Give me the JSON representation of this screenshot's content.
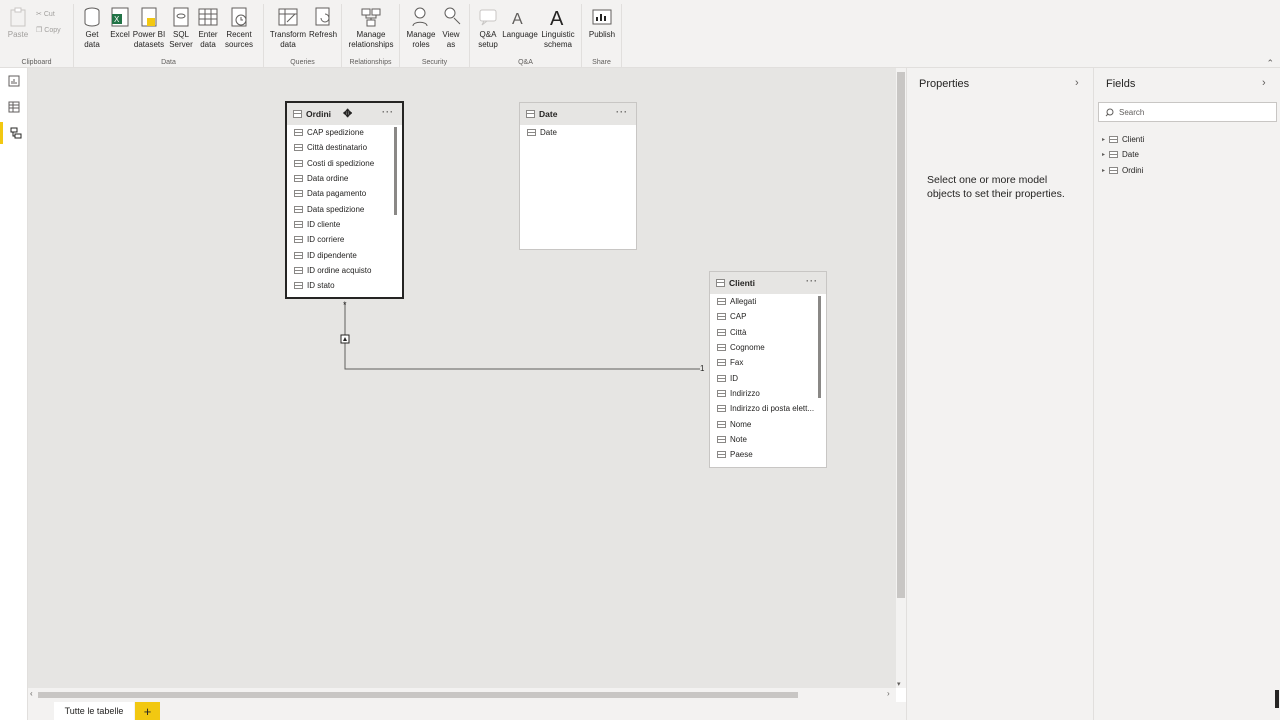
{
  "ribbon": {
    "clipboard": {
      "label": "Clipboard",
      "paste": "Paste",
      "cut": "Cut",
      "copy": "Copy"
    },
    "data": {
      "label": "Data",
      "get_data": "Get data",
      "excel": "Excel",
      "powerbi": "Power BI datasets",
      "sql": "SQL Server",
      "enter": "Enter data",
      "recent": "Recent sources"
    },
    "queries": {
      "label": "Queries",
      "transform": "Transform data",
      "refresh": "Refresh"
    },
    "relationships": {
      "label": "Relationships",
      "manage": "Manage relationships"
    },
    "security": {
      "label": "Security",
      "manage_roles": "Manage roles",
      "view_as": "View as"
    },
    "qa": {
      "label": "Q&A",
      "setup": "Q&A setup",
      "language": "Language",
      "linguistic": "Linguistic schema"
    },
    "share": {
      "label": "Share",
      "publish": "Publish"
    }
  },
  "tables": {
    "ordini": {
      "name": "Ordini",
      "fields": [
        "CAP spedizione",
        "Città destinatario",
        "Costi di spedizione",
        "Data ordine",
        "Data pagamento",
        "Data spedizione",
        "ID cliente",
        "ID corriere",
        "ID dipendente",
        "ID ordine acquisto",
        "ID stato"
      ]
    },
    "date": {
      "name": "Date",
      "fields": [
        "Date"
      ]
    },
    "clienti": {
      "name": "Clienti",
      "fields": [
        "Allegati",
        "CAP",
        "Città",
        "Cognome",
        "Fax",
        "ID",
        "Indirizzo",
        "Indirizzo di posta elett...",
        "Nome",
        "Note",
        "Paese"
      ]
    }
  },
  "relationship": {
    "from": "Ordini",
    "to": "Clienti",
    "one_side_label": "1",
    "many_side_label": "*"
  },
  "tabs": {
    "active": "Tutte le tabelle",
    "add": "+"
  },
  "properties": {
    "title": "Properties",
    "message": "Select one or more model objects to set their properties."
  },
  "fields_pane": {
    "title": "Fields",
    "search_placeholder": "Search",
    "items": [
      "Clienti",
      "Date",
      "Ordini"
    ]
  },
  "colors": {
    "accent": "#f2c811",
    "canvas": "#e6e5e3",
    "pane": "#f3f2f1"
  }
}
